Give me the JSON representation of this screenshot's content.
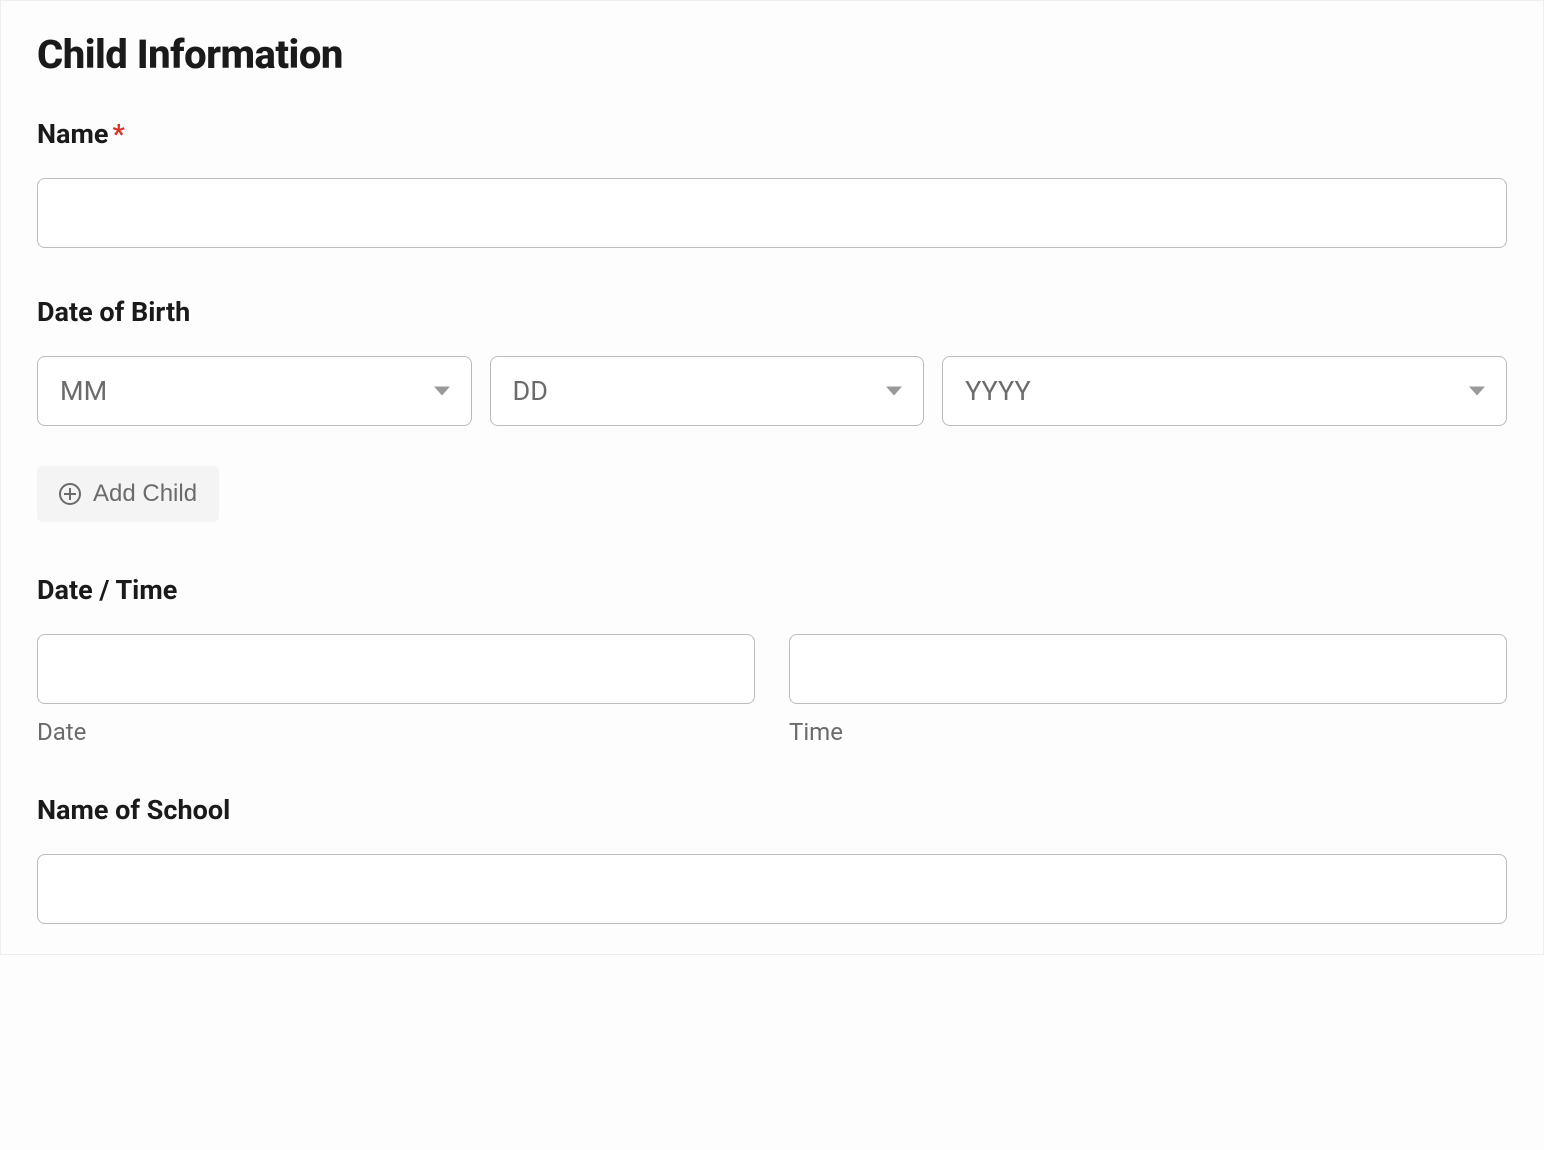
{
  "section_title": "Child Information",
  "fields": {
    "name": {
      "label": "Name",
      "required_mark": "*"
    },
    "dob": {
      "label": "Date of Birth",
      "month_placeholder": "MM",
      "day_placeholder": "DD",
      "year_placeholder": "YYYY"
    },
    "add_child": {
      "label": "Add Child"
    },
    "datetime": {
      "label": "Date / Time",
      "date_sublabel": "Date",
      "time_sublabel": "Time"
    },
    "school": {
      "label": "Name of School"
    }
  }
}
